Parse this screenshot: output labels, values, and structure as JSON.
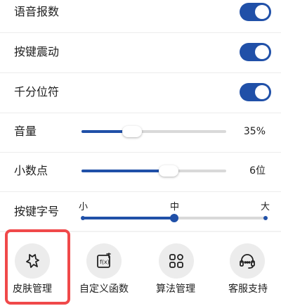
{
  "toggles": [
    {
      "label": "语音报数",
      "on": true
    },
    {
      "label": "按键震动",
      "on": true
    },
    {
      "label": "千分位符",
      "on": true
    }
  ],
  "sliders": [
    {
      "label": "音量",
      "value_text": "35%",
      "level": 0.35
    },
    {
      "label": "小数点",
      "value_text": "6位",
      "level": 0.6
    }
  ],
  "size": {
    "label": "按键字号",
    "min_label": "小",
    "mid_label": "中",
    "max_label": "大",
    "selected": "中"
  },
  "tools": [
    {
      "label": "皮肤管理",
      "icon": "skin-icon",
      "highlighted": true
    },
    {
      "label": "自定义函数",
      "icon": "function-icon",
      "highlighted": false
    },
    {
      "label": "算法管理",
      "icon": "apps-icon",
      "highlighted": false
    },
    {
      "label": "客服支持",
      "icon": "headset-icon",
      "highlighted": false
    }
  ],
  "colors": {
    "accent": "#2050a8",
    "highlight": "#f0494a",
    "track": "#d9d9d9"
  }
}
